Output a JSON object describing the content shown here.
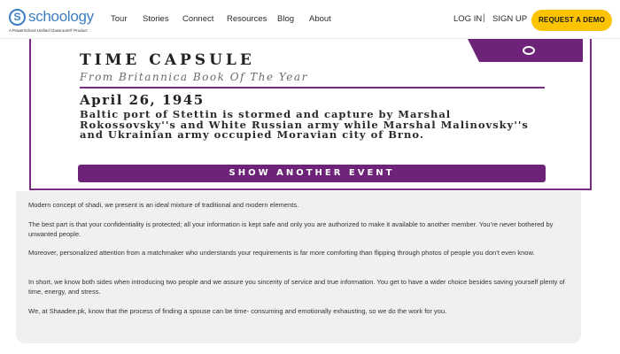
{
  "nav": {
    "logo_mark": "S",
    "logo_text": "schoology",
    "logo_tagline": "A PowerSchool Unified Classroom® Product",
    "links": [
      "Tour",
      "Stories",
      "Connect",
      "Resources",
      "Blog",
      "About"
    ],
    "login": "LOG IN",
    "separator": "|",
    "signup": "SIGN UP",
    "cta": "REQUEST A DEMO",
    "cta_color": "#fbc300",
    "brand_color": "#3d7ec2"
  },
  "capsule": {
    "title": "TIME CAPSULE",
    "source": "From Britannica Book Of The Year",
    "date": "April 26, 1945",
    "event": "Baltic port of Stettin is stormed and capture by Marshal Rokossovsky''s and White Russian army while Marshal Malinovsky''s and Ukrainian army occupied Moravian city of Brno.",
    "button": "SHOW ANOTHER EVENT",
    "accent_color": "#6d2378",
    "icon": "capsule-icon"
  },
  "article": {
    "paragraphs": [
      "Modern concept of shadi, we present is an ideal mixture of traditional and modern elements.",
      "The best part is that your confidentiality is protected; all your information is kept safe and only you are authorized to make it available to another member. You’re never bothered by unwanted people.",
      "Moreover, personalized attention from a matchmaker who understands your requirements is far more comforting than flipping through photos of people you don’t even know.",
      "In short, we know both sides when introducing two people and we assure you sincerity of service and true information. You get to have a wider choice besides saving yourself plenty of time, energy, and stress.",
      "We, at Shaadee.pk, know that the process of finding a spouse can be time- consuming and emotionally exhausting, so we do the work for you."
    ]
  }
}
